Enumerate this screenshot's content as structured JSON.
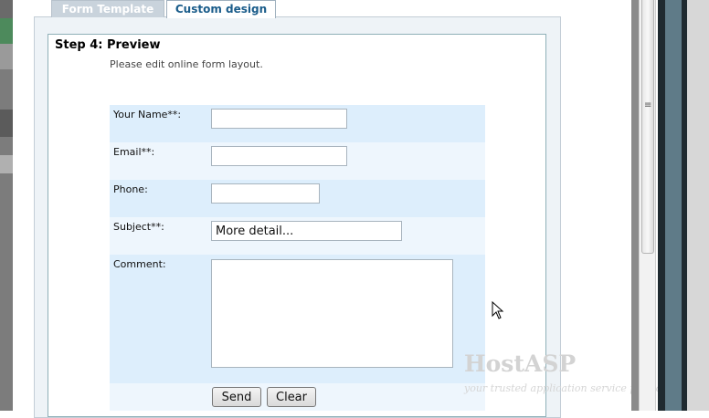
{
  "tabs": [
    {
      "label": "Form Template",
      "active": false
    },
    {
      "label": "Custom design",
      "active": true
    }
  ],
  "step": {
    "title": "Step 4: Preview",
    "description": "Please edit online form layout."
  },
  "form": {
    "fields": [
      {
        "label": "Your Name**:",
        "value": ""
      },
      {
        "label": "Email**:",
        "value": ""
      },
      {
        "label": "Phone:",
        "value": ""
      },
      {
        "label": "Subject**:",
        "value": "More detail..."
      },
      {
        "label": "Comment:",
        "value": ""
      }
    ],
    "send_label": "Send",
    "clear_label": "Clear"
  },
  "watermark": {
    "title": "HostASP",
    "subtitle": "your trusted application service provider"
  },
  "colors": {
    "tab_active_text": "#1a5c8a",
    "row_light": "#ddeefc",
    "row_lighter": "#eef6fd"
  },
  "icons": {
    "cursor": "arrow-cursor-icon",
    "scroll_grip": "grip-icon"
  }
}
